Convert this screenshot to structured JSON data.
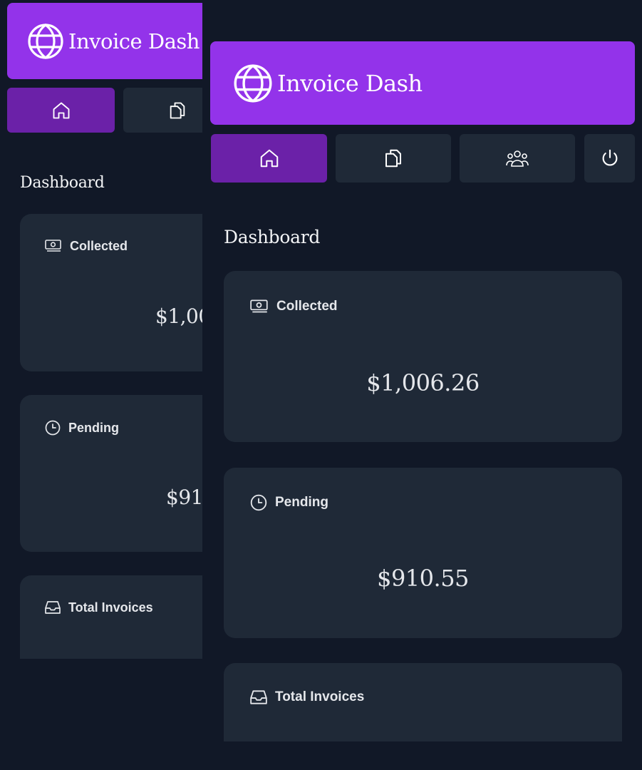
{
  "app": {
    "title": "Invoice Dash",
    "accent_color": "#9333ea",
    "active_nav_color": "#6b21a8",
    "background_color": "#111827",
    "card_color": "#1f2937"
  },
  "nav": {
    "items": [
      {
        "icon": "home-icon",
        "active": true
      },
      {
        "icon": "documents-icon",
        "active": false
      },
      {
        "icon": "customers-icon",
        "active": false
      },
      {
        "icon": "power-icon",
        "active": false
      }
    ]
  },
  "main": {
    "section_title": "Dashboard",
    "cards": [
      {
        "label": "Collected",
        "icon": "banknote-icon",
        "value": "$1,006.26"
      },
      {
        "label": "Pending",
        "icon": "clock-icon",
        "value": "$910.55"
      },
      {
        "label": "Total Invoices",
        "icon": "inbox-icon",
        "value": ""
      }
    ]
  },
  "back_panel": {
    "title_visible": "Invoice Dash",
    "collected_value_visible": "$1,00",
    "pending_value_visible": "$91("
  }
}
